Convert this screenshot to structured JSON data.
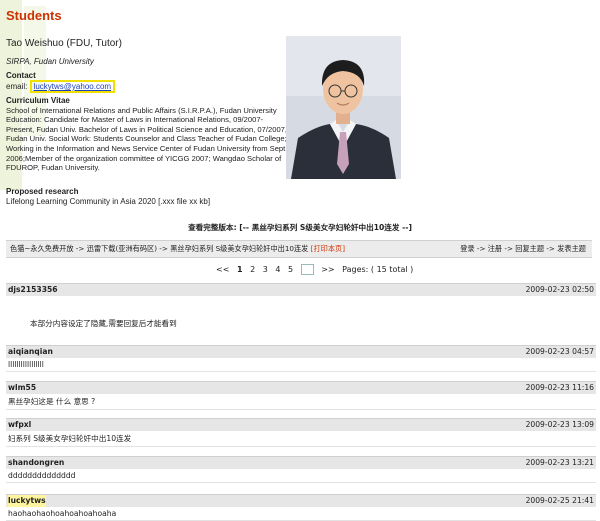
{
  "title": "Students",
  "person": {
    "name": "Tao Weishuo (FDU, Tutor)",
    "affiliation": "SIRPA, Fudan University"
  },
  "contact": {
    "heading": "Contact",
    "email_label": "email:",
    "email": "luckytws@yahoo.com"
  },
  "cv": {
    "heading": "Curriculum Vitae",
    "text": "School of International Relations and Public Affairs (S.I.R.P.A.), Fudan University Education: Candidate for Master of Laws in International Relations, 09/2007-Present, Fudan Univ. Bachelor of Laws in Political Science and Education, 07/2007, Fudan Univ. Social Work: Students Counselor and Class Teacher of Fudan College; Working in the Information and News Service Center of Fudan University from Sept. 2006;Member of the organization committee of YICGG 2007; Wangdao Scholar of FDUROP, Fudan University."
  },
  "research": {
    "heading": "Proposed research",
    "text": "Lifelong Learning Community in Asia 2020 [.xxx file xx kb]"
  },
  "full_version": "查看完整版本: [-- 黑丝孕妇系列 S级美女孕妇轮奸中出10连发 --]",
  "nav": {
    "left": "色猫~永久免费开放 -> 迅雷下载(亚洲有码区) -> 黑丝孕妇系列 S级美女孕妇轮奸中出10连发",
    "print": "[打印本页]",
    "right": "登录 -> 注册 -> 回复主题 -> 发表主题"
  },
  "pager": {
    "prev": "<<",
    "pages": [
      "1",
      "2",
      "3",
      "4",
      "5"
    ],
    "current": "1",
    "next": ">>",
    "total": "Pages: ( 15 total )"
  },
  "posts": [
    {
      "user": "djs2153356",
      "time": "2009-02-23 02:50",
      "body": "本部分内容设定了隐藏,需要回复后才能看到"
    },
    {
      "user": "aiqianqian",
      "time": "2009-02-23 04:57",
      "body": "lllllllllllllllll"
    },
    {
      "user": "wlm55",
      "time": "2009-02-23 11:16",
      "body": "黑丝孕妇这是 什么 意思 ?"
    },
    {
      "user": "wfpxl",
      "time": "2009-02-23 13:09",
      "body": "妇系列 S级美女孕妇轮奸中出10连发"
    },
    {
      "user": "shandongren",
      "time": "2009-02-23 13:21",
      "body": "dddddddddddddd"
    },
    {
      "user": "luckytws",
      "time": "2009-02-25 21:41",
      "body": "haohaohaohoahoahoahoaha"
    }
  ],
  "colors": {
    "title": "#cc3300",
    "highlight": "#f0e000",
    "link": "#1a3fbf"
  }
}
